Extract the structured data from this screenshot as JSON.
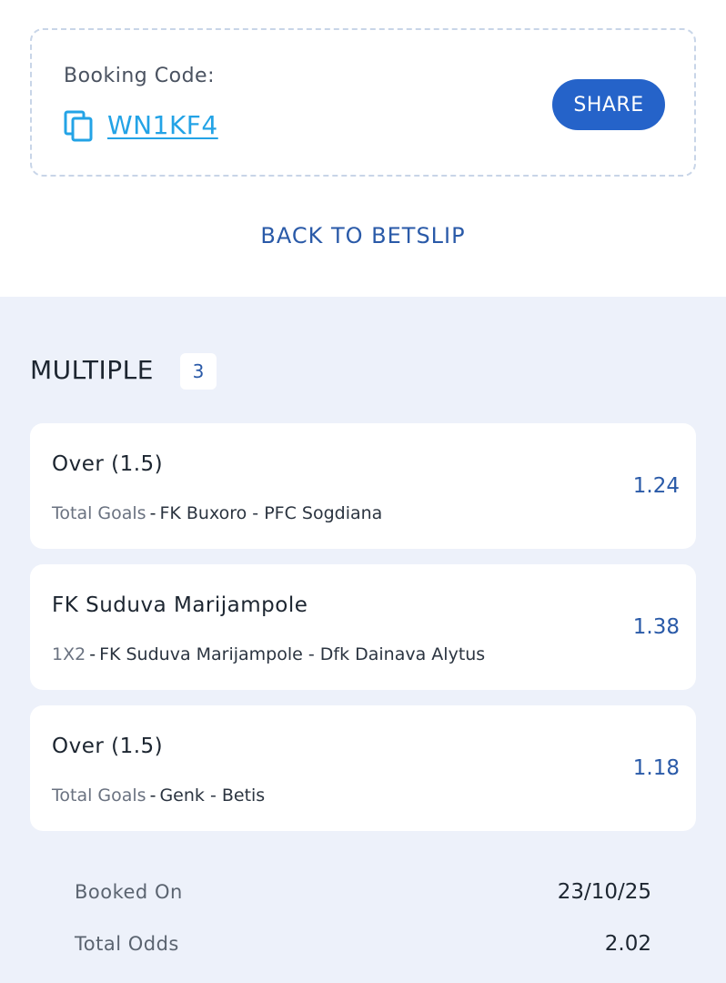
{
  "booking": {
    "label": "Booking Code:",
    "code": "WN1KF4",
    "share_label": "SHARE",
    "back_label": "BACK TO BETSLIP"
  },
  "multiple": {
    "title": "MULTIPLE",
    "count": "3"
  },
  "bets": [
    {
      "selection": "Over (1.5)",
      "market": "Total Goals",
      "separator": "-",
      "match": "FK Buxoro - PFC Sogdiana",
      "odds": "1.24"
    },
    {
      "selection": "FK Suduva Marijampole",
      "market": "1X2",
      "separator": "-",
      "match": "FK Suduva Marijampole - Dfk Dainava Alytus",
      "odds": "1.38"
    },
    {
      "selection": "Over (1.5)",
      "market": "Total Goals",
      "separator": "-",
      "match": "Genk - Betis",
      "odds": "1.18"
    }
  ],
  "summary": {
    "booked_on_label": "Booked On",
    "booked_on_value": "23/10/25",
    "total_odds_label": "Total Odds",
    "total_odds_value": "2.02"
  },
  "colors": {
    "accent": "#2563c9",
    "link": "#23a3e6",
    "background": "#edf1fa"
  }
}
